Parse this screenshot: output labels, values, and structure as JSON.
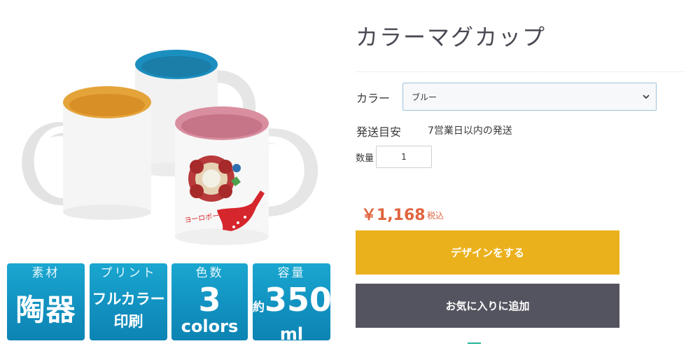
{
  "product": {
    "title": "カラーマグカップ",
    "image_alt": "mug-photo"
  },
  "badges": [
    {
      "label": "素材",
      "value": "陶器"
    },
    {
      "label": "プリント",
      "value_line1": "フルカラー",
      "value_line2": "印刷"
    },
    {
      "label": "色数",
      "value_num": "3",
      "value_unit": "colors"
    },
    {
      "label": "容量",
      "value_prefix": "約",
      "value_num": "350",
      "value_unit": "ml"
    }
  ],
  "form": {
    "color_label": "カラー",
    "color_selected": "ブルー",
    "shipping_label": "発送目安",
    "shipping_value": "7営業日以内の発送",
    "quantity_label": "数量",
    "quantity_value": "1"
  },
  "pricing": {
    "price": "￥1,168",
    "tax_note": "税込"
  },
  "actions": {
    "design_label": "デザインをする",
    "favorite_label": "お気に入りに追加"
  },
  "colors": {
    "design_button": "#ebb11d",
    "favorite_button": "#545460",
    "price": "#e0643f",
    "badge": "#1190bf"
  }
}
